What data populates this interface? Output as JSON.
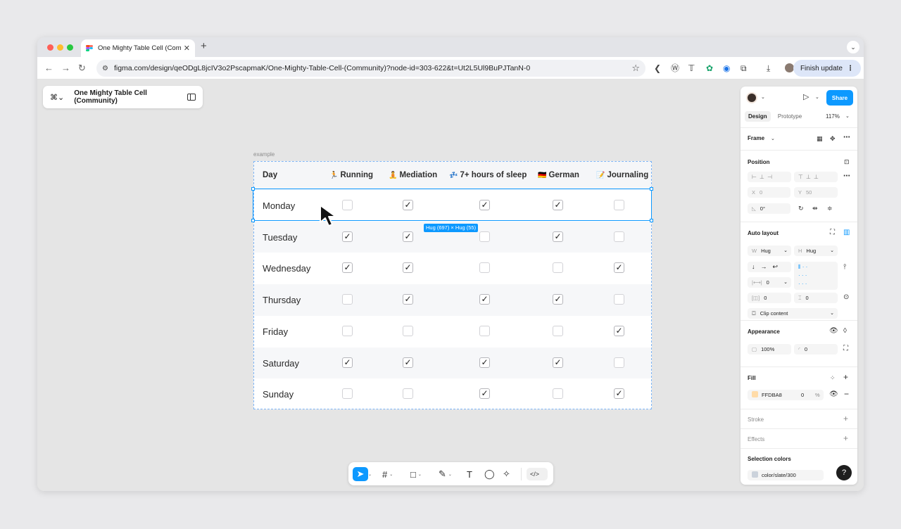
{
  "browser": {
    "tab_title": "One Mighty Table Cell (Comm",
    "tab_close": "✕",
    "new_tab": "+",
    "tab_menu": "⌄",
    "url": "figma.com/design/qeODgL8jcIV3o2PscapmaK/One-Mighty-Table-Cell-(Community)?node-id=303-622&t=Ut2L5Ul9BuPJTanN-0",
    "finish_update": "Finish update",
    "icons": [
      "back-icon",
      "forward-icon",
      "reload-icon",
      "site-settings-icon",
      "bookmark-star-icon",
      "extensions-icon",
      "download-icon",
      "profile-icon",
      "menu-kebab-icon"
    ]
  },
  "figma": {
    "file_name": "One Mighty Table Cell (Community)",
    "frame_label": "example",
    "hug_badge": "Hug (697) × Hug (55)"
  },
  "table": {
    "headers": [
      {
        "emoji": "🏃",
        "label": "Running"
      },
      {
        "emoji": "🧘",
        "label": "Mediation"
      },
      {
        "emoji": "💤",
        "label": "7+ hours of sleep"
      },
      {
        "emoji": "🇩🇪",
        "label": "German"
      },
      {
        "emoji": "📝",
        "label": "Journaling"
      }
    ],
    "day_header": "Day",
    "rows": [
      {
        "day": "Monday",
        "checks": [
          false,
          true,
          true,
          true,
          false
        ]
      },
      {
        "day": "Tuesday",
        "checks": [
          true,
          true,
          false,
          true,
          false
        ]
      },
      {
        "day": "Wednesday",
        "checks": [
          true,
          true,
          false,
          false,
          true
        ]
      },
      {
        "day": "Thursday",
        "checks": [
          false,
          true,
          true,
          true,
          false
        ]
      },
      {
        "day": "Friday",
        "checks": [
          false,
          false,
          false,
          false,
          true
        ]
      },
      {
        "day": "Saturday",
        "checks": [
          true,
          true,
          true,
          true,
          false
        ]
      },
      {
        "day": "Sunday",
        "checks": [
          false,
          false,
          true,
          false,
          true
        ]
      }
    ]
  },
  "toolbar": {
    "tools": [
      "move-tool",
      "frame-tool",
      "rectangle-tool",
      "pen-tool",
      "text-tool",
      "comment-tool",
      "actions-tool"
    ],
    "dev_mode": "</>"
  },
  "panel": {
    "tab_design": "Design",
    "tab_prototype": "Prototype",
    "zoom": "117%",
    "share": "Share",
    "frame_type": "Frame",
    "position_title": "Position",
    "x_label": "X",
    "x_value": "0",
    "y_label": "Y",
    "y_value": "50",
    "rotation": "0°",
    "auto_layout_title": "Auto layout",
    "w_label": "W",
    "w_value": "Hug",
    "h_label": "H",
    "h_value": "Hug",
    "gap": "0",
    "padding_h": "0",
    "padding_v": "0",
    "clip_content": "Clip content",
    "appearance_title": "Appearance",
    "opacity": "100%",
    "radius": "0",
    "fill_title": "Fill",
    "fill_hex": "FFDBA8",
    "fill_opacity": "0",
    "fill_percent": "%",
    "fill_color": "#FFDBA8",
    "stroke_title": "Stroke",
    "effects_title": "Effects",
    "selection_colors_title": "Selection colors",
    "selection_color_name": "color/slate/300",
    "selection_color": "#CBD2DB",
    "help": "?"
  },
  "colors": {
    "accent": "#0D99FF"
  }
}
